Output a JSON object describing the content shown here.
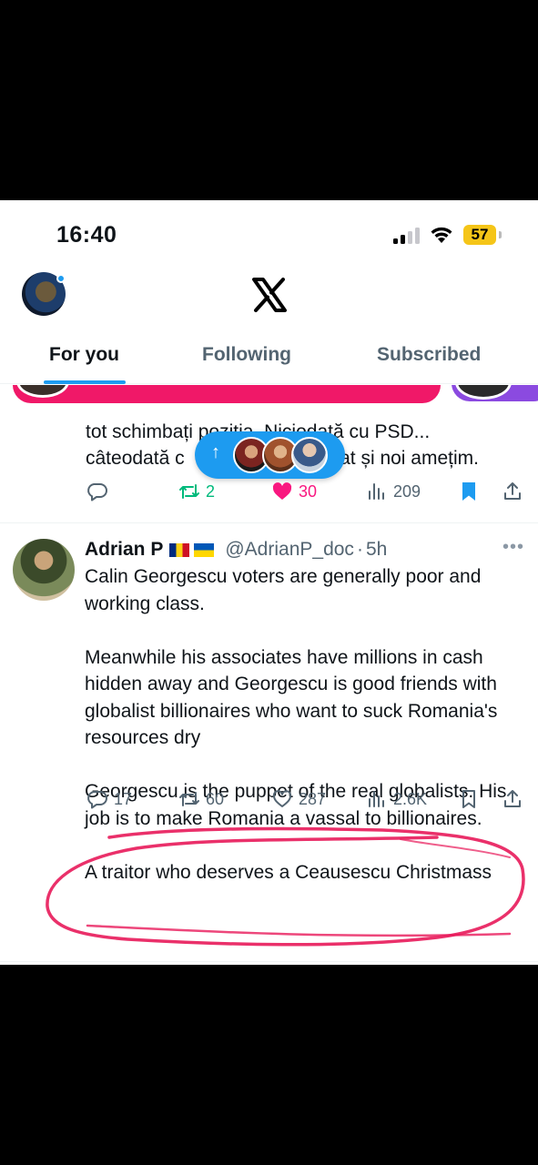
{
  "status_bar": {
    "time": "16:40",
    "battery_level": "57",
    "icons": [
      "cellular-signal-icon",
      "wifi-icon",
      "battery-icon"
    ]
  },
  "header": {
    "logo": "x-logo-icon",
    "avatar": "profile-avatar"
  },
  "tabs": [
    {
      "label": "For you",
      "active": true
    },
    {
      "label": "Following",
      "active": false
    },
    {
      "label": "Subscribed",
      "active": false
    }
  ],
  "previous_tweet": {
    "text_line_1": "tot schimbați poziția. Niciodată cu PSD...",
    "text_line_2": "câteodată cu ... cat și noi amețim.",
    "text_line_2_left": "câteodată c",
    "text_line_2_right": "cat și noi amețim.",
    "text_line_1_left": "tot schimbați poziția. Niciodată cu PSD...",
    "replies": "",
    "reposts": "2",
    "likes": "30",
    "views": "209"
  },
  "new_posts_pill": {
    "arrow": "↑",
    "avatars": 3
  },
  "tweet": {
    "author_name": "Adrian P",
    "flags": [
      "🇷🇴",
      "🇺🇦"
    ],
    "handle": "@AdrianP_doc",
    "separator": "·",
    "time": "5h",
    "more": "•••",
    "paragraphs": [
      "Calin Georgescu voters are generally poor and working class.",
      "Meanwhile his associates have millions in cash hidden away and Georgescu is good friends with globalist billionaires who want to suck Romania's resources dry",
      "Georgescu is the puppet of the real globalists. His job is to make Romania a vassal to billionaires.",
      "A traitor who deserves a Ceausescu Christmass"
    ],
    "replies": "17",
    "reposts": "60",
    "likes": "287",
    "views": "2.6K"
  },
  "colors": {
    "accent": "#1d9bf0",
    "repost_green": "#00ba7c",
    "like_pink": "#f91880",
    "secondary_text": "#536471",
    "annotation_red": "#e8195a"
  }
}
